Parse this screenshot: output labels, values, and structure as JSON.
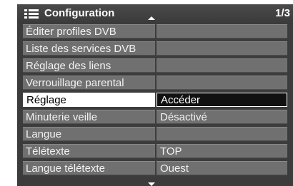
{
  "header": {
    "menu_icon": "list-menu-icon",
    "title": "Configuration",
    "page_indicator": "1/3",
    "scroll_up_icon": "triangle-up-icon",
    "scroll_down_icon": "triangle-down-icon"
  },
  "items": [
    {
      "label": "Éditer profiles DVB",
      "value": ""
    },
    {
      "label": "Liste des services DVB",
      "value": ""
    },
    {
      "label": "Réglage des liens",
      "value": ""
    },
    {
      "label": "Verrouillage parental",
      "value": ""
    },
    {
      "label": "Réglage",
      "value": "Accéder",
      "selected": true
    },
    {
      "label": "Minuterie veille",
      "value": "Désactivé"
    },
    {
      "label": "Langue",
      "value": ""
    },
    {
      "label": "Télétexte",
      "value": "TOP"
    },
    {
      "label": "Langue télétexte",
      "value": "Ouest"
    }
  ],
  "colors": {
    "background": "#3c3c3c",
    "item": "#707070",
    "selected_label": "#ffffff",
    "selected_value": "#111111"
  }
}
